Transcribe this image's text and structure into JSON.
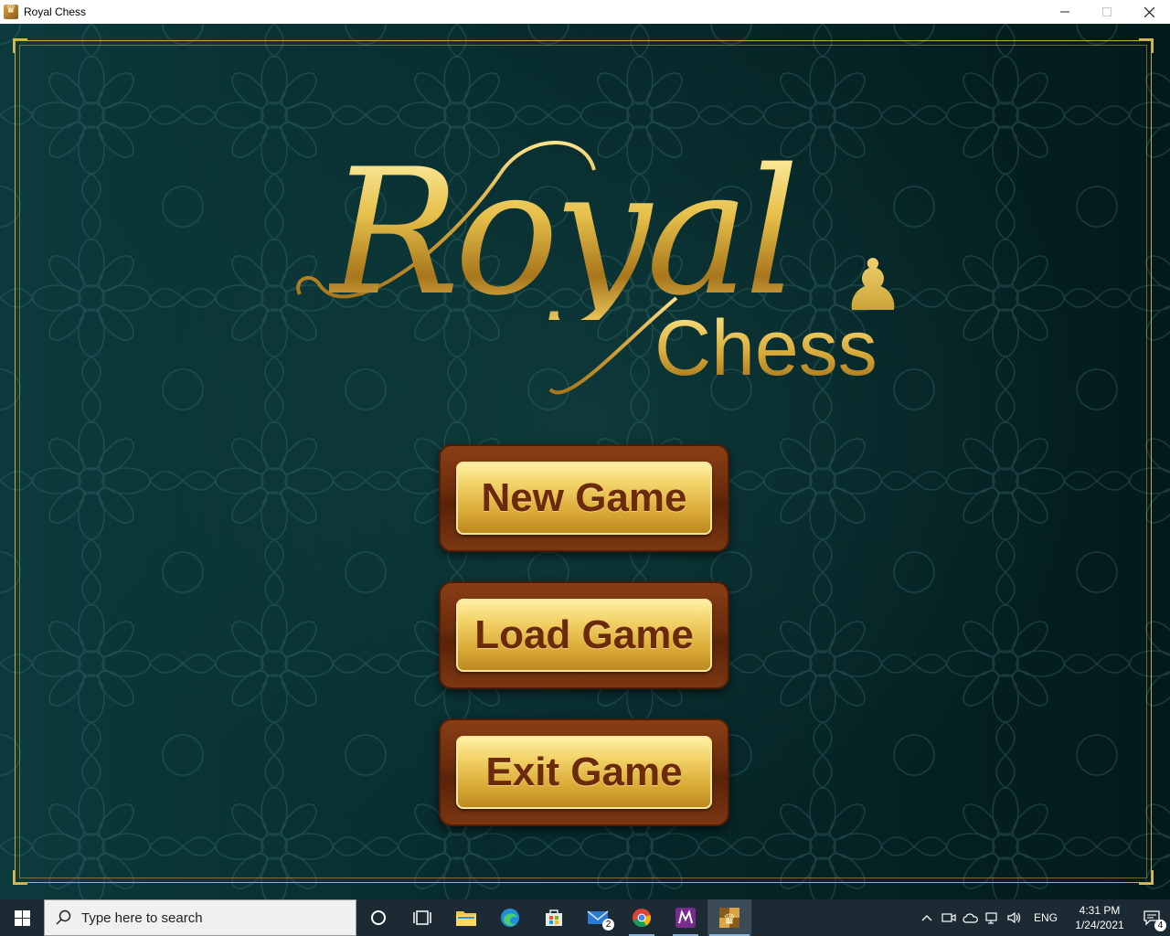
{
  "window": {
    "title": "Royal Chess",
    "controls": {
      "minimize": "—",
      "maximize": "☐",
      "close": "✕"
    }
  },
  "logo": {
    "royal": "Royal",
    "chess": "Chess",
    "pawn_icon": "pawn-icon"
  },
  "menu": {
    "new_game": "New Game",
    "load_game": "Load Game",
    "exit_game": "Exit Game"
  },
  "taskbar": {
    "search_placeholder": "Type here to search",
    "apps": [
      {
        "name": "cortana",
        "icon": "circle-icon"
      },
      {
        "name": "task-view",
        "icon": "task-view-icon"
      },
      {
        "name": "file-explorer",
        "icon": "folder-icon"
      },
      {
        "name": "edge",
        "icon": "edge-icon"
      },
      {
        "name": "store",
        "icon": "store-icon"
      },
      {
        "name": "mail",
        "icon": "mail-icon",
        "badge": "2"
      },
      {
        "name": "chrome",
        "icon": "chrome-icon"
      },
      {
        "name": "app-m",
        "icon": "m-app-icon"
      },
      {
        "name": "royal-chess",
        "icon": "royal-chess-icon"
      }
    ],
    "tray": {
      "language": "ENG",
      "time": "4:31 PM",
      "date": "1/24/2021",
      "notification_count": "4"
    }
  },
  "colors": {
    "background": "#072a2c",
    "gold": "#d9ab3a",
    "wood": "#6a2c0c",
    "button_text": "#6b2a0a",
    "taskbar": "#1c2a34"
  }
}
